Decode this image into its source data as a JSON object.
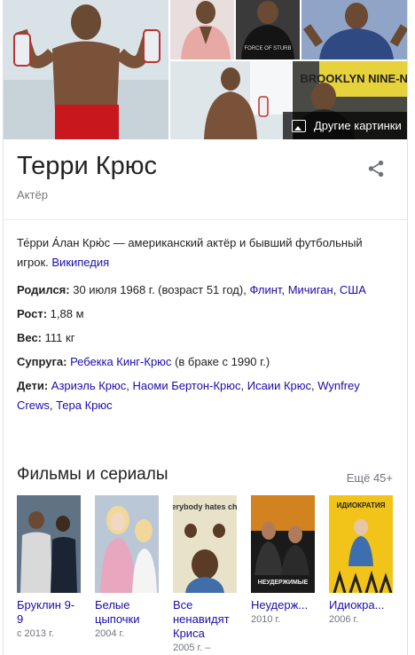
{
  "images": {
    "more_label": "Другие картинки",
    "collage": [
      "main-photo",
      "photo-pink-shirt",
      "photo-black-shirt",
      "photo-blue-shirt",
      "photo-holding-bottle",
      "photo-brooklyn-nine-nine"
    ],
    "photo_captions": {
      "black_shirt": "FORCE OF STURB",
      "brooklyn": "BROOKLYN NINE-NINE"
    }
  },
  "entity": {
    "name": "Терри Крюс",
    "subtitle": "Актёр",
    "share_icon": "share-icon"
  },
  "description": {
    "text": "Те́рри А́лан Крю́с — американский актёр и бывший футбольный игрок.",
    "source": "Википедия"
  },
  "facts": {
    "born": {
      "label": "Родился:",
      "text": "30 июля 1968 г. (возраст 51 год),",
      "links": [
        "Флинт",
        "Мичиган",
        "США"
      ]
    },
    "height": {
      "label": "Рост:",
      "value": "1,88 м"
    },
    "weight": {
      "label": "Вес:",
      "value": "111 кг"
    },
    "spouse": {
      "label": "Супруга:",
      "link": "Ребекка Кинг-Крюс",
      "extra": "(в браке с 1990 г.)"
    },
    "children": {
      "label": "Дети:",
      "links": [
        "Азриэль Крюс",
        "Наоми Бертон-Крюс",
        "Исаии Крюс",
        "Wynfrey Crews",
        "Тера Крюс"
      ]
    }
  },
  "films": {
    "title": "Фильмы и сериалы",
    "more": "Ещё 45+",
    "items": [
      {
        "title": "Бруклин 9-9",
        "year": "с 2013 г."
      },
      {
        "title": "Белые цыпочки",
        "year": "2004 г."
      },
      {
        "title": "Все ненавидят Криса",
        "year": "2005 г. –",
        "poster_text": "everybody hates chris"
      },
      {
        "title": "Неудерж...",
        "year": "2010 г.",
        "poster_text": "НЕУДЕРЖИМЫЕ"
      },
      {
        "title": "Идиокра...",
        "year": "2006 г.",
        "poster_text": "ИДИОКРАТИЯ"
      }
    ]
  },
  "colors": {
    "link": "#1a0dab",
    "muted": "#70757a",
    "border": "#dfe1e5"
  }
}
